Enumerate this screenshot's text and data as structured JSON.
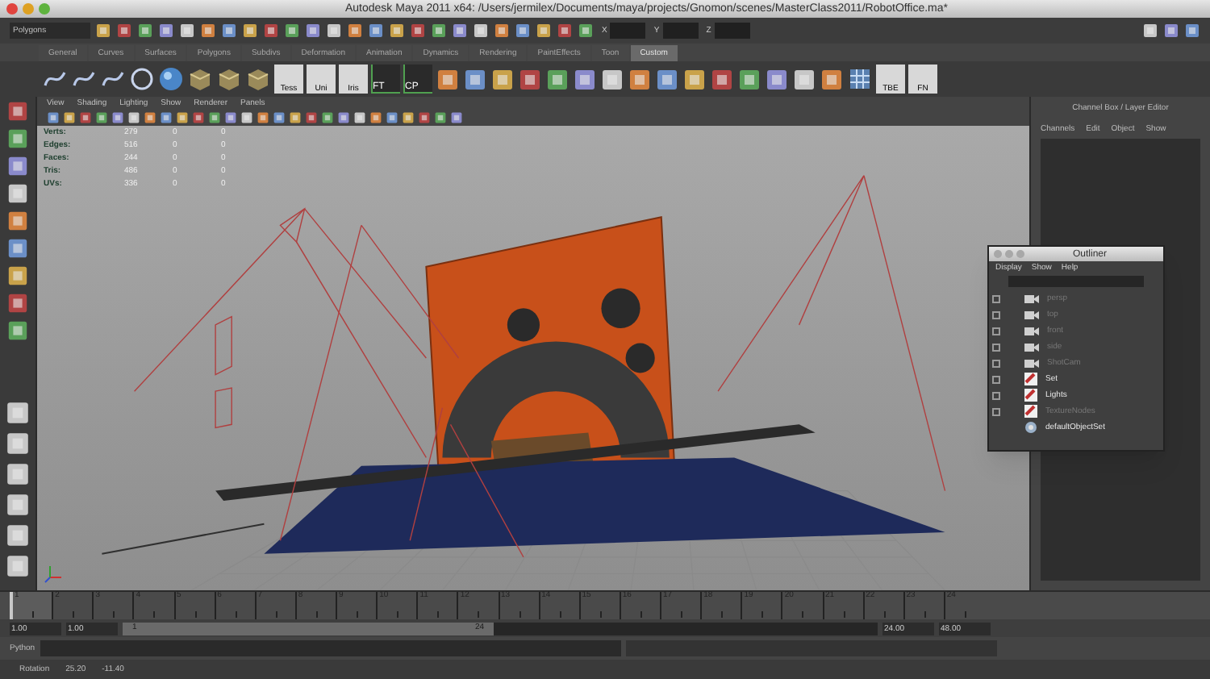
{
  "window": {
    "title": "Autodesk Maya 2011 x64: /Users/jermilex/Documents/maya/projects/Gnomon/scenes/MasterClass2011/RobotOffice.ma*"
  },
  "status_line": {
    "menu_set": "Polygons",
    "fields": [
      {
        "label": "X"
      },
      {
        "label": "Y"
      },
      {
        "label": "Z"
      }
    ]
  },
  "shelf": {
    "tabs": [
      {
        "label": "General",
        "selected": false
      },
      {
        "label": "Curves",
        "selected": false
      },
      {
        "label": "Surfaces",
        "selected": false
      },
      {
        "label": "Polygons",
        "selected": false
      },
      {
        "label": "Subdivs",
        "selected": false
      },
      {
        "label": "Deformation",
        "selected": false
      },
      {
        "label": "Animation",
        "selected": false
      },
      {
        "label": "Dynamics",
        "selected": false
      },
      {
        "label": "Rendering",
        "selected": false
      },
      {
        "label": "PaintEffects",
        "selected": false
      },
      {
        "label": "Toon",
        "selected": false
      },
      {
        "label": "Custom",
        "selected": true
      }
    ],
    "buttons": [
      {
        "kind": "curve"
      },
      {
        "kind": "curve"
      },
      {
        "kind": "curve"
      },
      {
        "kind": "circle"
      },
      {
        "kind": "sphere"
      },
      {
        "kind": "box"
      },
      {
        "kind": "box"
      },
      {
        "kind": "box"
      },
      {
        "kind": "labeled",
        "label": "Tess"
      },
      {
        "kind": "labeled",
        "label": "Uni"
      },
      {
        "kind": "labeled",
        "label": "Iris"
      },
      {
        "kind": "axis",
        "label": "FT"
      },
      {
        "kind": "axis",
        "label": "CP"
      },
      {
        "kind": "tool"
      },
      {
        "kind": "tool"
      },
      {
        "kind": "tool"
      },
      {
        "kind": "tool"
      },
      {
        "kind": "tool"
      },
      {
        "kind": "tool"
      },
      {
        "kind": "tool"
      },
      {
        "kind": "tool"
      },
      {
        "kind": "tool"
      },
      {
        "kind": "tool"
      },
      {
        "kind": "tool"
      },
      {
        "kind": "tool"
      },
      {
        "kind": "tool"
      },
      {
        "kind": "tool"
      },
      {
        "kind": "tool"
      },
      {
        "kind": "lattice"
      },
      {
        "kind": "labeled",
        "label": "TBE"
      },
      {
        "kind": "labeled",
        "label": "FN"
      }
    ]
  },
  "viewport": {
    "menus": [
      "View",
      "Shading",
      "Lighting",
      "Show",
      "Renderer",
      "Panels"
    ],
    "hud": [
      {
        "label": "Verts:",
        "values": [
          "279",
          "0",
          "0"
        ]
      },
      {
        "label": "Edges:",
        "values": [
          "516",
          "0",
          "0"
        ]
      },
      {
        "label": "Faces:",
        "values": [
          "244",
          "0",
          "0"
        ]
      },
      {
        "label": "Tris:",
        "values": [
          "486",
          "0",
          "0"
        ]
      },
      {
        "label": "UVs:",
        "values": [
          "336",
          "0",
          "0"
        ]
      }
    ]
  },
  "channel_box": {
    "title": "Channel Box / Layer Editor",
    "menus": [
      "Channels",
      "Edit",
      "Object",
      "Show"
    ]
  },
  "outliner": {
    "title": "Outliner",
    "menus": [
      "Display",
      "Show",
      "Help"
    ],
    "items": [
      {
        "label": "persp",
        "kind": "camera",
        "disabled": true
      },
      {
        "label": "top",
        "kind": "camera",
        "disabled": true
      },
      {
        "label": "front",
        "kind": "camera",
        "disabled": true
      },
      {
        "label": "side",
        "kind": "camera",
        "disabled": true
      },
      {
        "label": "ShotCam",
        "kind": "camera",
        "disabled": true
      },
      {
        "label": "Set",
        "kind": "group",
        "disabled": false
      },
      {
        "label": "Lights",
        "kind": "group",
        "disabled": false
      },
      {
        "label": "TextureNodes",
        "kind": "group",
        "disabled": true
      },
      {
        "label": "defaultObjectSet",
        "kind": "set",
        "disabled": false
      }
    ]
  },
  "time_slider": {
    "ticks": [
      {
        "label": "1",
        "selected": true
      },
      {
        "label": "2",
        "selected": false
      },
      {
        "label": "3",
        "selected": false
      },
      {
        "label": "4",
        "selected": false
      },
      {
        "label": "5",
        "selected": false
      },
      {
        "label": "6",
        "selected": false
      },
      {
        "label": "7",
        "selected": false
      },
      {
        "label": "8",
        "selected": false
      },
      {
        "label": "9",
        "selected": false
      },
      {
        "label": "10",
        "selected": false
      },
      {
        "label": "11",
        "selected": false
      },
      {
        "label": "12",
        "selected": false
      },
      {
        "label": "13",
        "selected": false
      },
      {
        "label": "14",
        "selected": false
      },
      {
        "label": "15",
        "selected": false
      },
      {
        "label": "16",
        "selected": false
      },
      {
        "label": "17",
        "selected": false
      },
      {
        "label": "18",
        "selected": false
      },
      {
        "label": "19",
        "selected": false
      },
      {
        "label": "20",
        "selected": false
      },
      {
        "label": "21",
        "selected": false
      },
      {
        "label": "22",
        "selected": false
      },
      {
        "label": "23",
        "selected": false
      },
      {
        "label": "24",
        "selected": false
      }
    ]
  },
  "range_slider": {
    "start": "1.00",
    "playback_start": "1.00",
    "bar_start": "1",
    "bar_end": "24",
    "playback_end": "24.00",
    "end": "48.00"
  },
  "command_line": {
    "label": "Python"
  },
  "help_line": {
    "label": "Rotation",
    "values": [
      "25.20",
      "-11.40"
    ]
  }
}
